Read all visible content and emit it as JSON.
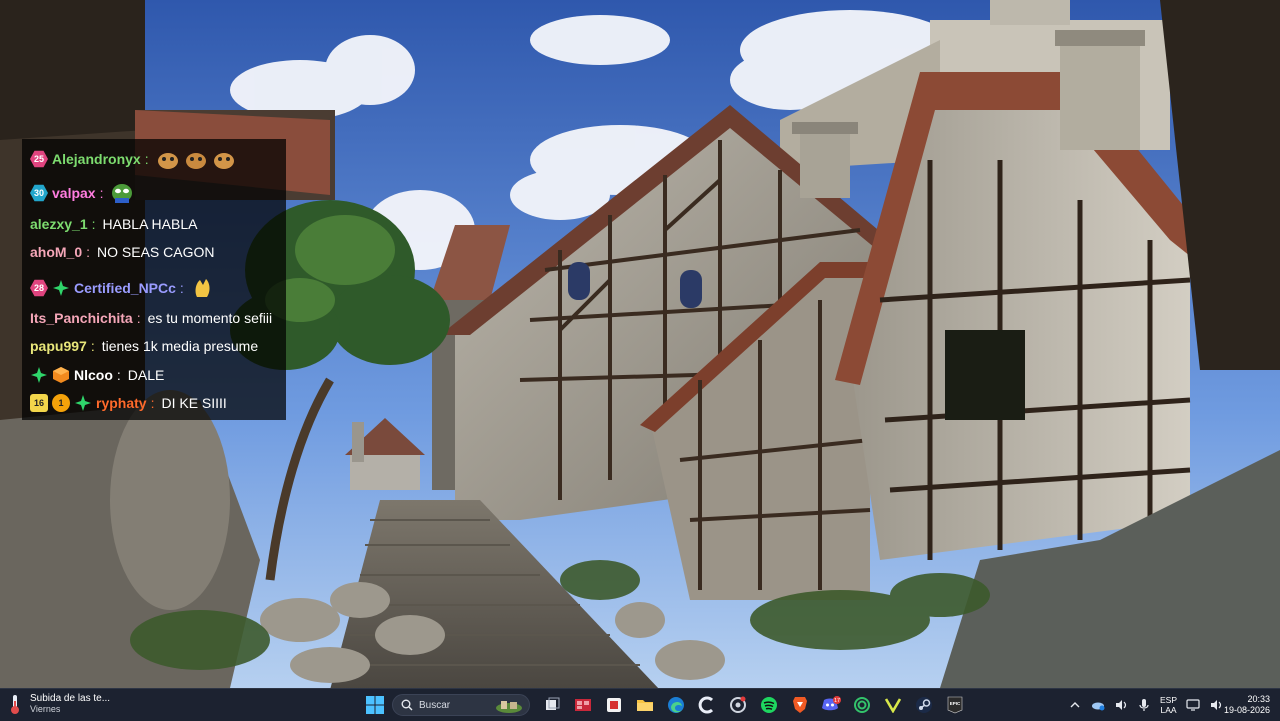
{
  "wallpaper": {
    "description_colors": {
      "sky_top": "#3a62b4",
      "sky_bottom": "#9cc0ee",
      "stone": "#8e8a80",
      "roof": "#9a4f38",
      "timber": "#3b2c22"
    }
  },
  "chat": {
    "messages": [
      {
        "badges": [
          "sub-25"
        ],
        "user": "Alejandronyx",
        "user_color": "#7ddc6f",
        "text": "",
        "emotes": [
          "hamster-emote",
          "hamster-emote",
          "hamster-emote"
        ]
      },
      {
        "badges": [
          "sub-30"
        ],
        "user": "valpax",
        "user_color": "#ff7de0",
        "text": "",
        "emotes": [
          "pepe-emote"
        ]
      },
      {
        "badges": [],
        "user": "alezxy_1",
        "user_color": "#7ddc6f",
        "text": "HABLA HABLA",
        "emotes": []
      },
      {
        "badges": [],
        "user": "ahoM_0",
        "user_color": "#f5a6b8",
        "text": "NO SEAS CAGON",
        "emotes": []
      },
      {
        "badges": [
          "sub-28",
          "star"
        ],
        "user": "Certified_NPCc",
        "user_color": "#9a9cff",
        "text": "",
        "emotes": [
          "clap-emote"
        ]
      },
      {
        "badges": [],
        "user": "Its_Panchichita",
        "user_color": "#f5a6b8",
        "text": "es tu momento sefiii",
        "emotes": []
      },
      {
        "badges": [],
        "user": "papu997",
        "user_color": "#e8e67a",
        "text": "tienes 1k media presume",
        "emotes": []
      },
      {
        "badges": [
          "star",
          "cube"
        ],
        "user": "Nlcoo",
        "user_color": "#ffffff",
        "text": "DALE",
        "emotes": []
      },
      {
        "badges": [
          "sub-16",
          "bits-1",
          "star"
        ],
        "user": "ryphaty",
        "user_color": "#ff6a2b",
        "text": "DI KE SIIII",
        "emotes": []
      }
    ],
    "badge_labels": {
      "sub-25": "25",
      "sub-30": "30",
      "sub-28": "28",
      "sub-16": "16",
      "bits-1": "1"
    },
    "separator": ":"
  },
  "taskbar": {
    "weather": {
      "title": "Subida de las te...",
      "subtitle": "Viernes"
    },
    "search": {
      "label": "Buscar"
    },
    "apps": [
      "file-manager-icon",
      "media-store-icon",
      "snipping-tool-icon",
      "folder-icon",
      "edge-icon",
      "c-browser-icon",
      "settings-icon",
      "spotify-icon",
      "brave-icon",
      "discord-icon",
      "nvidia-icon",
      "vpn-icon",
      "steam-icon",
      "epic-games-icon"
    ],
    "epic_label": "EPIC",
    "discord_badge": "17",
    "tray": {
      "lang_top": "ESP",
      "lang_bottom": "LAA"
    },
    "clock": {
      "time": "20:33",
      "date": "19-08-2026"
    }
  }
}
